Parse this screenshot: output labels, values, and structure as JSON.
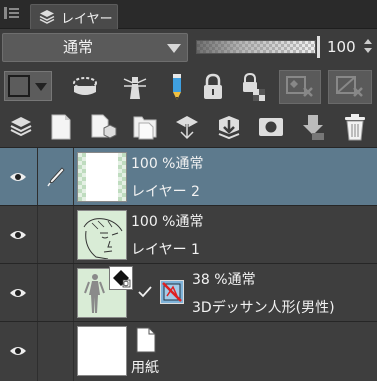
{
  "tab": {
    "label": "レイヤー"
  },
  "blend": {
    "mode": "通常"
  },
  "opacity": {
    "value": "100",
    "level": 1.0
  },
  "layers": [
    {
      "percent": "100 %通常",
      "name": "レイヤー 2",
      "selected": true
    },
    {
      "percent": "100 %通常",
      "name": "レイヤー 1",
      "selected": false
    },
    {
      "percent": "38 %通常",
      "name": "3Dデッサン人形(男性)",
      "selected": false
    },
    {
      "percent": "",
      "name": "用紙",
      "selected": false
    }
  ]
}
